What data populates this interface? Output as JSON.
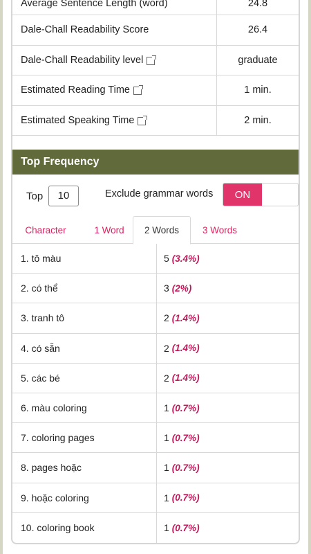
{
  "stats": [
    {
      "label": "Average Sentence Length (word)",
      "value": "24.8",
      "link": false
    },
    {
      "label": "Dale-Chall Readability Score",
      "value": "26.4",
      "link": false
    },
    {
      "label": "Dale-Chall Readability level",
      "value": "graduate",
      "link": true
    },
    {
      "label": "Estimated Reading Time",
      "value": "1 min.",
      "link": true
    },
    {
      "label": "Estimated Speaking Time",
      "value": "2 min.",
      "link": true
    }
  ],
  "top_frequency": {
    "title": "Top Frequency",
    "top_label": "Top",
    "top_value": "10",
    "exclude_label": "Exclude grammar words",
    "toggle_label": "ON",
    "tabs": [
      "Character",
      "1 Word",
      "2 Words",
      "3 Words"
    ],
    "active_tab": "2 Words",
    "rows": [
      {
        "phrase": "1. tô màu",
        "count": "5",
        "pct": "(3.4%)"
      },
      {
        "phrase": "2. có thể",
        "count": "3",
        "pct": "(2%)"
      },
      {
        "phrase": "3. tranh tô",
        "count": "2",
        "pct": "(1.4%)"
      },
      {
        "phrase": "4. có sẵn",
        "count": "2",
        "pct": "(1.4%)"
      },
      {
        "phrase": "5. các bé",
        "count": "2",
        "pct": "(1.4%)"
      },
      {
        "phrase": "6. màu coloring",
        "count": "1",
        "pct": "(0.7%)"
      },
      {
        "phrase": "7. coloring pages",
        "count": "1",
        "pct": "(0.7%)"
      },
      {
        "phrase": "8. pages hoặc",
        "count": "1",
        "pct": "(0.7%)"
      },
      {
        "phrase": "9. hoặc coloring",
        "count": "1",
        "pct": "(0.7%)"
      },
      {
        "phrase": "10. coloring book",
        "count": "1",
        "pct": "(0.7%)"
      }
    ]
  },
  "colors": {
    "header_bg": "#606a3a",
    "accent": "#e0346b",
    "pct_text": "#c2185b"
  }
}
